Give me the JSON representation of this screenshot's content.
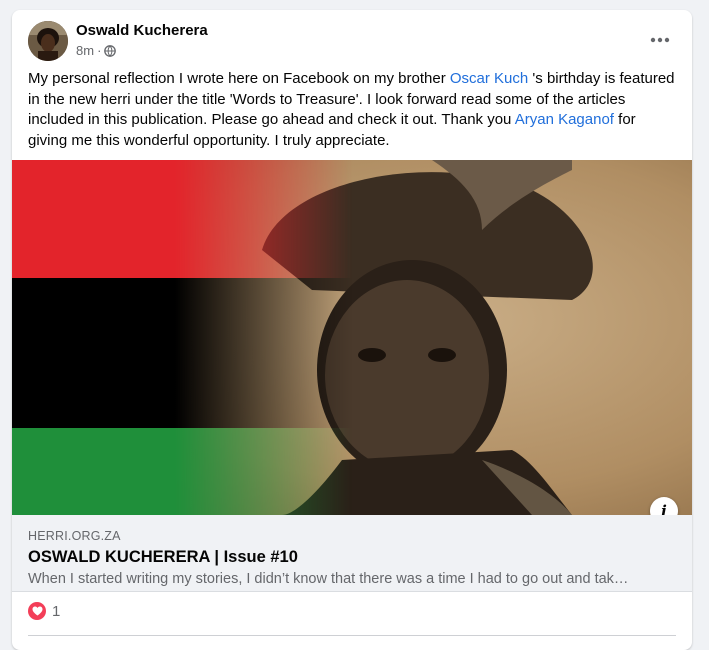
{
  "post": {
    "author": "Oswald Kucherera",
    "time": "8m",
    "separator": "·",
    "privacy_icon": "globe-icon",
    "text_before": "My personal reflection I wrote here on Facebook on my brother ",
    "mention1": "Oscar Kuch",
    "text_middle": " 's birthday is featured in the new herri under the title 'Words to Treasure'. I look forward read some of the articles included in this publication. Please go ahead and check it out. Thank you ",
    "mention2": "Aryan Kaganof",
    "text_after": " for giving me this wonderful opportunity.  I truly appreciate."
  },
  "link_preview": {
    "domain": "HERRI.ORG.ZA",
    "title": "OSWALD KUCHERERA | Issue #10",
    "description": "When I started writing my stories, I didn’t know that there was a time I had to go out and tak…",
    "info_label": "i"
  },
  "reactions": {
    "icon": "love-reaction-icon",
    "count": "1"
  },
  "colors": {
    "link": "#216fdb",
    "flag_red": "#e3242b",
    "flag_black": "#000000",
    "flag_green": "#1f8f3a",
    "love": "#f33e58"
  }
}
